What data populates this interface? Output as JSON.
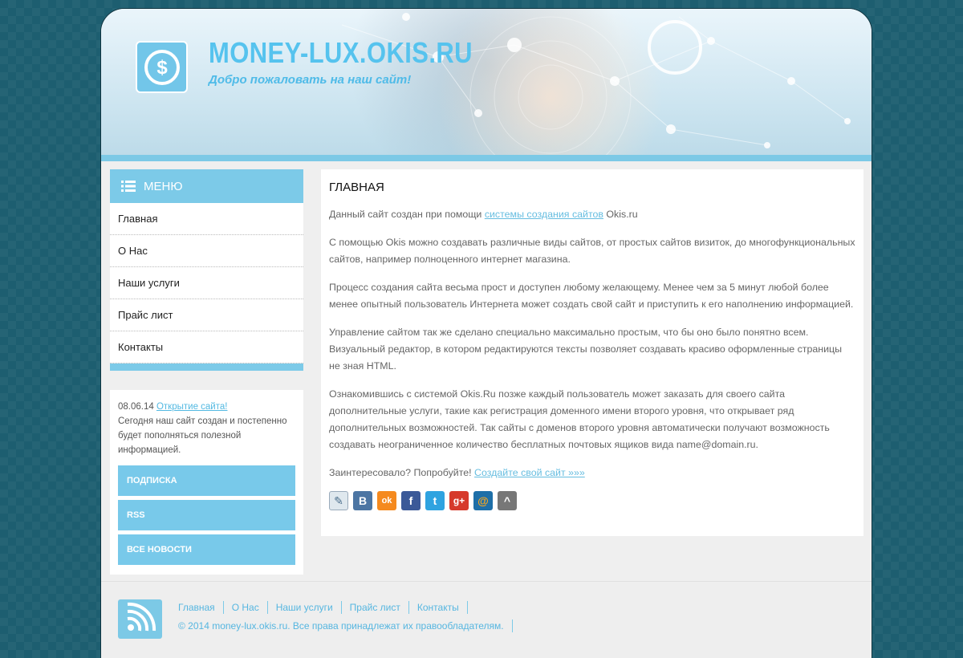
{
  "header": {
    "title": "MONEY-LUX.OKIS.RU",
    "slogan": "Добро пожаловать на наш сайт!",
    "logo_icon": "dollar-icon",
    "accent_color": "#56c3ee"
  },
  "menu": {
    "title": "МЕНЮ",
    "icon": "list-icon",
    "items": [
      {
        "label": "Главная"
      },
      {
        "label": "О Нас"
      },
      {
        "label": "Наши услуги"
      },
      {
        "label": "Прайс лист"
      },
      {
        "label": "Контакты"
      }
    ]
  },
  "news": {
    "date": "08.06.14",
    "link": "Открытие сайта!",
    "text": "Сегодня наш сайт создан и постепенно будет пополняться полезной информацией.",
    "buttons": [
      "ПОДПИСКА",
      "RSS",
      "ВСЕ НОВОСТИ"
    ]
  },
  "content": {
    "title": "ГЛАВНАЯ",
    "p1_before": "Данный сайт создан при помощи ",
    "p1_link": "системы создания сайтов",
    "p1_after": " Okis.ru",
    "p2": "С помощью Okis можно создавать различные виды сайтов, от простых сайтов визиток, до многофункциональных сайтов, например полноценного интернет магазина.",
    "p3": "Процесс создания сайта весьма прост и доступен любому желающему. Менее чем за 5 минут любой более менее опытный пользователь Интернета может создать свой сайт и приступить к его наполнению информацией.",
    "p4": "Управление сайтом так же сделано специально максимально простым, что бы оно было понятно всем. Визуальный редактор, в котором редактируются тексты позволяет создавать красиво оформленные страницы не зная HTML.",
    "p5": "Ознакомившись с системой Okis.Ru позже каждый пользователь может заказать для своего сайта дополнительные услуги, такие как регистрация доменного имени второго уровня, что открывает ряд дополнительных возможностей. Так сайты с доменов второго уровня автоматически получают возможность создавать неограниченное количество бесплатных почтовых ящиков вида name@domain.ru.",
    "p6_before": "Заинтересовало? Попробуйте! ",
    "p6_link": "Создайте свой сайт »»»",
    "social": [
      {
        "icon": "livejournal-icon",
        "glyph": "✎",
        "color": "#dfe8ee"
      },
      {
        "icon": "vkontakte-icon",
        "glyph": "B",
        "color": "#4c75a3"
      },
      {
        "icon": "odnoklassniki-icon",
        "glyph": "ok",
        "color": "#f58a1f"
      },
      {
        "icon": "facebook-icon",
        "glyph": "f",
        "color": "#3b5998"
      },
      {
        "icon": "twitter-icon",
        "glyph": "t",
        "color": "#2fa3e0"
      },
      {
        "icon": "google-plus-icon",
        "glyph": "g+",
        "color": "#d6392b"
      },
      {
        "icon": "mail-ru-icon",
        "glyph": "@",
        "color": "#1e6fa8"
      },
      {
        "icon": "more-share-icon",
        "glyph": "^",
        "color": "#777777"
      }
    ]
  },
  "footer": {
    "icon": "rss-icon",
    "nav": [
      "Главная",
      "О Нас",
      "Наши услуги",
      "Прайс лист",
      "Контакты"
    ],
    "copyright": "© 2014 money-lux.okis.ru. Все права принадлежат их правообладателям."
  }
}
